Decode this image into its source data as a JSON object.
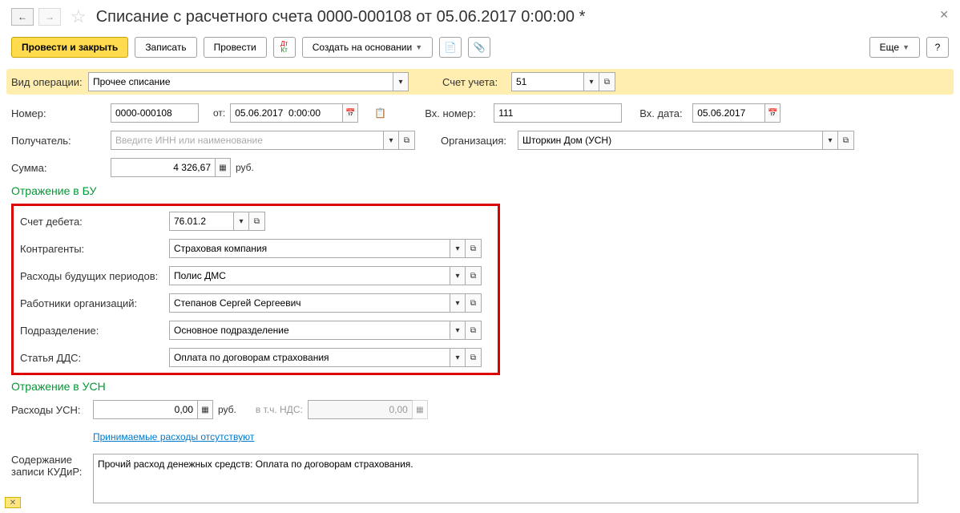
{
  "header": {
    "title": "Списание с расчетного счета 0000-000108 от 05.06.2017 0:00:00 *"
  },
  "toolbar": {
    "post_close": "Провести и закрыть",
    "save": "Записать",
    "post": "Провести",
    "create_based_on": "Создать на основании",
    "more": "Еще",
    "help": "?"
  },
  "form": {
    "operation_type": {
      "label": "Вид операции:",
      "value": "Прочее списание"
    },
    "account": {
      "label": "Счет учета:",
      "value": "51"
    },
    "number": {
      "label": "Номер:",
      "value": "0000-000108"
    },
    "from_label": "от:",
    "date": "05.06.2017  0:00:00",
    "in_number": {
      "label": "Вх. номер:",
      "value": "111"
    },
    "in_date": {
      "label": "Вх. дата:",
      "value": "05.06.2017"
    },
    "recipient": {
      "label": "Получатель:",
      "placeholder": "Введите ИНН или наименование"
    },
    "organization": {
      "label": "Организация:",
      "value": "Шторкин Дом (УСН)"
    },
    "sum": {
      "label": "Сумма:",
      "value": "4 326,67",
      "currency": "руб."
    }
  },
  "bu": {
    "title": "Отражение в БУ",
    "debit_account": {
      "label": "Счет дебета:",
      "value": "76.01.2"
    },
    "counterparty": {
      "label": "Контрагенты:",
      "value": "Страховая компания"
    },
    "future_expenses": {
      "label": "Расходы будущих периодов:",
      "value": "Полис ДМС"
    },
    "workers": {
      "label": "Работники организаций:",
      "value": "Степанов Сергей Сергеевич"
    },
    "department": {
      "label": "Подразделение:",
      "value": "Основное подразделение"
    },
    "dds": {
      "label": "Статья ДДС:",
      "value": "Оплата по договорам страхования"
    }
  },
  "usn": {
    "title": "Отражение в УСН",
    "expenses": {
      "label": "Расходы УСН:",
      "value": "0,00",
      "currency": "руб."
    },
    "incl_vat_label": "в т.ч. НДС:",
    "incl_vat_value": "0,00",
    "link": "Принимаемые расходы отсутствуют",
    "kudir_label": "Содержание записи КУДиР:",
    "kudir_value": "Прочий расход денежных средств: Оплата по договорам страхования."
  },
  "icons": {
    "calendar": "📅",
    "drop": "▾",
    "popup": "⧉",
    "attach": "📎",
    "doc": "📄",
    "check": "✓"
  }
}
